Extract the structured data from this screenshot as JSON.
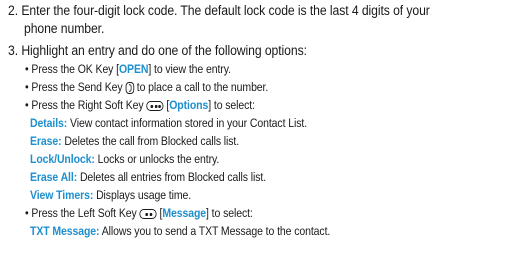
{
  "step2": {
    "number": "2.",
    "line1": "Enter the four-digit lock code. The default lock code is the last 4 digits of your",
    "line2": "phone number."
  },
  "step3": {
    "number": "3.",
    "text": "Highlight an entry and do one of the following options:",
    "ok": {
      "prefix": "• Press the OK Key [",
      "label": "OPEN",
      "suffix": "] to view the entry."
    },
    "send": {
      "prefix": "• Press the Send Key",
      "suffix": "to place a call to the number."
    },
    "right": {
      "prefix": "• Press the Right Soft Key",
      "open": " [",
      "label": "Options",
      "suffix": "] to select:"
    },
    "options": [
      {
        "term": "Details:",
        "desc": " View contact information stored in your Contact List."
      },
      {
        "term": "Erase:",
        "desc": " Deletes the call from Blocked calls list."
      },
      {
        "term": "Lock/Unlock:",
        "desc": " Locks or unlocks the entry."
      },
      {
        "term": "Erase All:",
        "desc": " Deletes all entries from Blocked calls list."
      },
      {
        "term": "View Timers:",
        "desc": " Displays usage time."
      }
    ],
    "left": {
      "prefix": "• Press the Left Soft Key",
      "open": " [",
      "label": "Message",
      "suffix": "] to select:"
    },
    "message_options": [
      {
        "term": "TXT Message:",
        "desc": " Allows you to send a TXT Message to the contact."
      }
    ]
  },
  "colors": {
    "accent": "#1e8fcf",
    "text": "#1a1a1a"
  },
  "icons": {
    "right_soft_key": "three-dot-soft-key-icon",
    "left_soft_key": "two-dot-soft-key-icon",
    "send_key": "send-key-icon"
  }
}
